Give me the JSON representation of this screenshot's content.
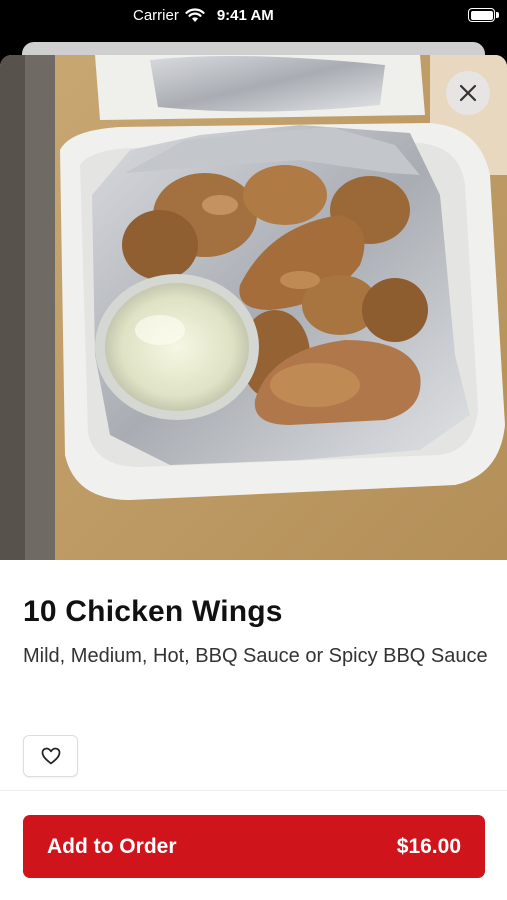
{
  "status_bar": {
    "carrier": "Carrier",
    "time": "9:41 AM"
  },
  "item": {
    "title": "10 Chicken Wings",
    "description": "Mild, Medium, Hot, BBQ Sauce or Spicy BBQ Sauce",
    "image": "chicken-wings-photo"
  },
  "actions": {
    "add_label": "Add to Order",
    "price": "$16.00",
    "favorite_icon": "heart-icon",
    "close_icon": "close-icon"
  },
  "colors": {
    "accent": "#d0141c"
  }
}
